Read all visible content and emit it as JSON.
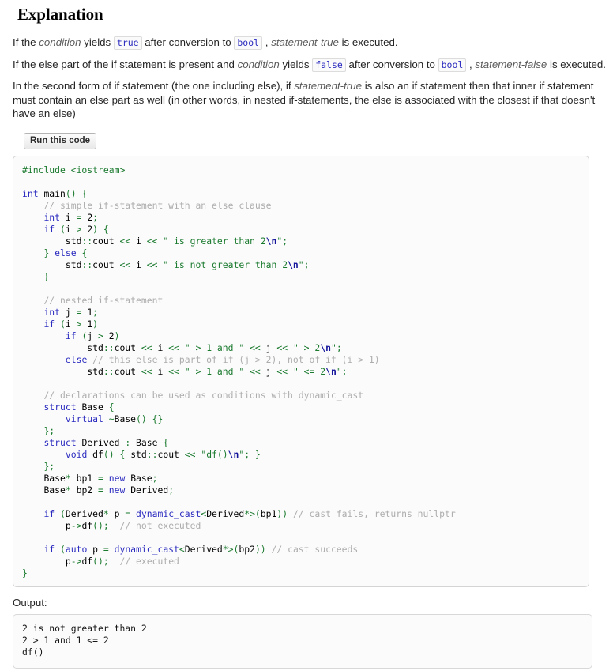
{
  "section": {
    "title": "Explanation"
  },
  "paragraphs": {
    "p1": {
      "t1": "If the ",
      "em1": "condition",
      "t2": " yields ",
      "code1": "true",
      "t3": " after conversion to ",
      "code2": "bool",
      "t4": " , ",
      "em2": "statement-true",
      "t5": " is executed."
    },
    "p2": {
      "t1": "If the else part of the if statement is present and ",
      "em1": "condition",
      "t2": " yields ",
      "code1": "false",
      "t3": " after conversion to ",
      "code2": "bool",
      "t4": " , ",
      "em2": "statement-false",
      "t5": " is executed."
    },
    "p3": {
      "t1": "In the second form of if statement (the one including else), if ",
      "em1": "statement-true",
      "t2": " is also an if statement then that inner if statement must contain an else part as well (in other words, in nested if-statements, the else is associated with the closest if that doesn't have an else)"
    }
  },
  "run_button": {
    "label": "Run this code"
  },
  "code": {
    "language": "cpp",
    "text": "#include <iostream>\n\nint main() {\n    // simple if-statement with an else clause\n    int i = 2;\n    if (i > 2) {\n        std::cout << i << \" is greater than 2\\n\";\n    } else {\n        std::cout << i << \" is not greater than 2\\n\";\n    }\n\n    // nested if-statement\n    int j = 1;\n    if (i > 1)\n        if (j > 2)\n            std::cout << i << \" > 1 and \" << j << \" > 2\\n\";\n        else // this else is part of if (j > 2), not of if (i > 1)\n            std::cout << i << \" > 1 and \" << j << \" <= 2\\n\";\n\n    // declarations can be used as conditions with dynamic_cast\n    struct Base {\n        virtual ~Base() {}\n    };\n    struct Derived : Base {\n        void df() { std::cout << \"df()\\n\"; }\n    };\n    Base* bp1 = new Base;\n    Base* bp2 = new Derived;\n\n    if (Derived* p = dynamic_cast<Derived*>(bp1)) // cast fails, returns nullptr\n        p->df();  // not executed\n\n    if (auto p = dynamic_cast<Derived*>(bp2)) // cast succeeds\n        p->df();  // executed\n}"
  },
  "output": {
    "label": "Output:",
    "text": "2 is not greater than 2\n2 > 1 and 1 <= 2\ndf()"
  },
  "colors": {
    "keyword": "#2b2bc0",
    "preprocessor": "#1a7a2e",
    "string": "#1a7a2e",
    "escape": "#15159c",
    "comment": "#adadad",
    "operator": "#1a7a2e",
    "plain": "#000000",
    "inline_code_text": "#2b2bc0",
    "box_border": "#d4d4d4",
    "box_background": "#fbfbfb"
  }
}
